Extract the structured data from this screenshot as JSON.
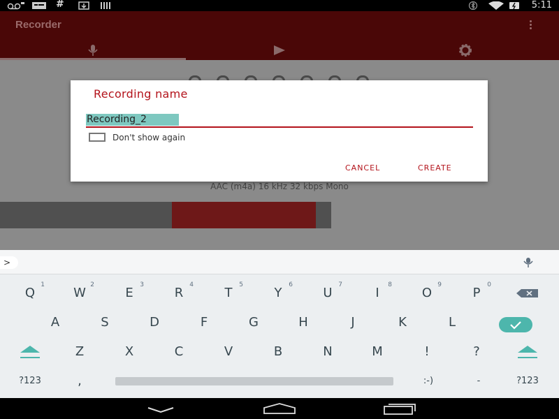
{
  "status_bar": {
    "time": "5:11",
    "icons": [
      "voicemail-icon",
      "message-icon",
      "hash-icon",
      "download-icon",
      "barcode-icon",
      "bluetooth-icon",
      "wifi-icon",
      "battery-icon"
    ]
  },
  "app": {
    "title": "Recorder",
    "tabs": [
      {
        "icon": "microphone-icon",
        "selected": true
      },
      {
        "icon": "play-icon",
        "selected": false
      },
      {
        "icon": "gear-icon",
        "selected": false
      }
    ],
    "format_info": "AAC (m4a) 16 kHz 32 kbps Mono"
  },
  "dialog": {
    "title": "Recording name",
    "input_value": "Recording_2",
    "checkbox_label": "Don't show again",
    "checkbox_checked": false,
    "cancel_label": "CANCEL",
    "create_label": "CREATE",
    "accent_color": "#b3131b"
  },
  "keyboard": {
    "row1": [
      "Q",
      "W",
      "E",
      "R",
      "T",
      "Y",
      "U",
      "I",
      "O",
      "P"
    ],
    "row1_hints": [
      "1",
      "2",
      "3",
      "4",
      "5",
      "6",
      "7",
      "8",
      "9",
      "0"
    ],
    "row2": [
      "A",
      "S",
      "D",
      "F",
      "G",
      "H",
      "J",
      "K",
      "L"
    ],
    "row3": [
      "Z",
      "X",
      "C",
      "V",
      "B",
      "N",
      "M",
      "!",
      "?"
    ],
    "symbols_label": "?123",
    "comma": ",",
    "smiley": ":-)",
    "dash": "-",
    "suggestion_arrow": ">",
    "enter_color": "#4db6ac"
  }
}
